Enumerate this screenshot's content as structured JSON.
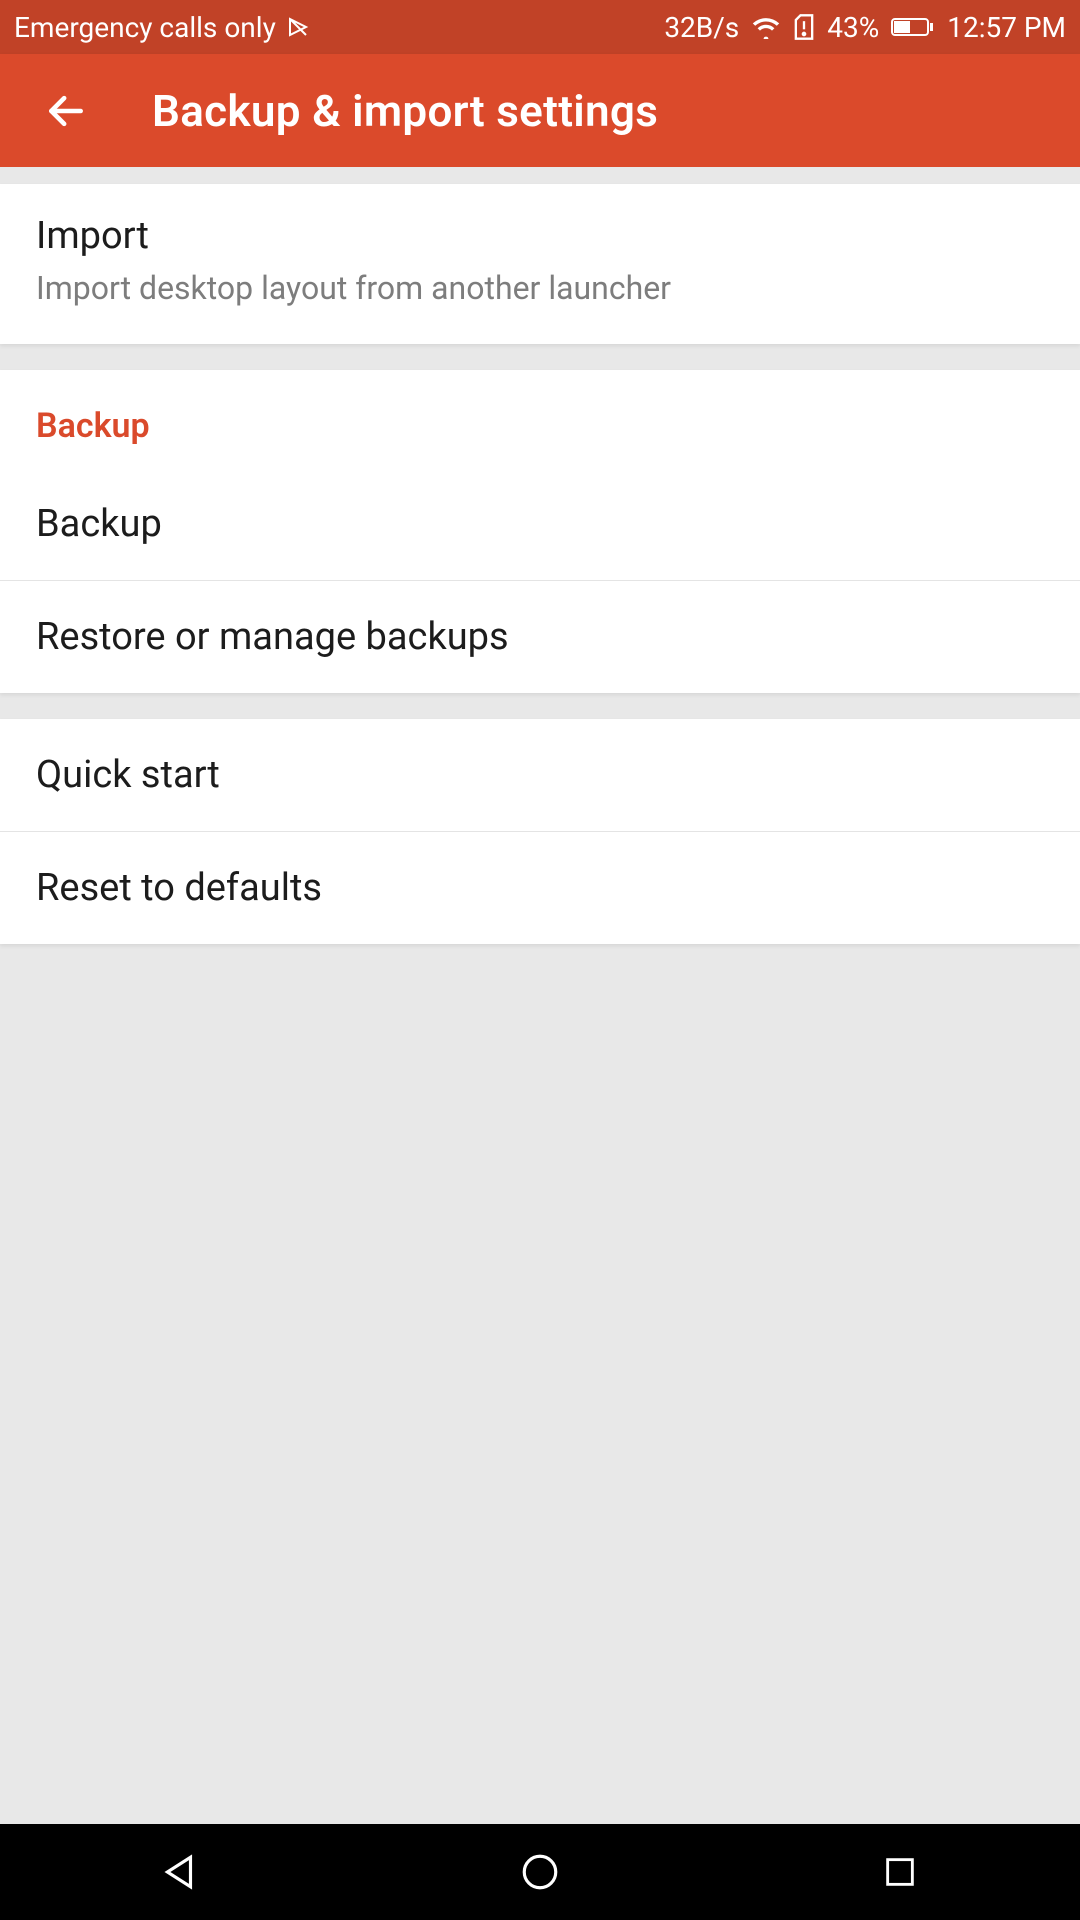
{
  "status": {
    "carrier": "Emergency calls only",
    "speed": "32B/s",
    "battery_pct": "43%",
    "time": "12:57 PM"
  },
  "header": {
    "title": "Backup & import settings"
  },
  "sections": {
    "import": {
      "title": "Import",
      "subtitle": "Import desktop layout from another launcher"
    },
    "backup_header": "Backup",
    "backup": {
      "title": "Backup"
    },
    "restore": {
      "title": "Restore or manage backups"
    },
    "quickstart": {
      "title": "Quick start"
    },
    "reset": {
      "title": "Reset to defaults"
    }
  },
  "colors": {
    "accent": "#db4a2b",
    "status_bar": "#c14227"
  }
}
